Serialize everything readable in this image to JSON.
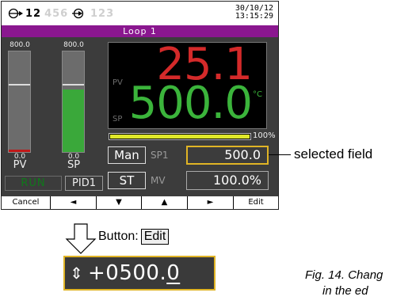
{
  "status_bar": {
    "loop_icon": "loop-arrow-icon",
    "group_a_active": "12",
    "group_a_inactive": "456",
    "group_b_icon": "circle-arrow-icon",
    "group_b_inactive": "123",
    "date": "30/10/12",
    "time": "13:15:29"
  },
  "loop_title": "Loop 1",
  "bars": {
    "pv": {
      "scale_top": "800.0",
      "scale_bottom": "0.0",
      "label": "PV",
      "fill_fraction": 0.0,
      "fill_color": "#c01818",
      "mark_fraction": 0.66
    },
    "sp": {
      "scale_top": "800.0",
      "scale_bottom": "0.0",
      "label": "SP",
      "fill_fraction": 0.62,
      "fill_color": "#3aa83a",
      "mark_fraction": 0.66
    }
  },
  "indicators": {
    "run": "RUN",
    "pid": "PID1"
  },
  "display": {
    "pv_tag": "PV",
    "sp_tag": "SP",
    "pv_value": "25.1",
    "sp_value": "500.0",
    "unit": "°C",
    "pv_color": "#d42a2a",
    "sp_color": "#3bb43b"
  },
  "mv_bar": {
    "percent": 100,
    "label": "100%",
    "color": "#dfe72a"
  },
  "controls": {
    "man_button": "Man",
    "st_button": "ST",
    "sp1_label": "SP1",
    "sp1_value": "500.0",
    "mv_label": "MV",
    "mv_value": "100.0%",
    "selected_color": "#e0b425"
  },
  "softkeys": {
    "cancel": "Cancel",
    "left": "◄",
    "down": "▼",
    "up": "▲",
    "right": "►",
    "edit": "Edit"
  },
  "callout": "selected field",
  "button_caption": {
    "prefix": "Button:",
    "key": "Edit"
  },
  "edit_field": {
    "arrows": "⇕",
    "value_main": "+0500.",
    "value_cursor": "0"
  },
  "figure_caption": {
    "line1": "Fig. 14. Chang",
    "line2": "in the ed"
  }
}
